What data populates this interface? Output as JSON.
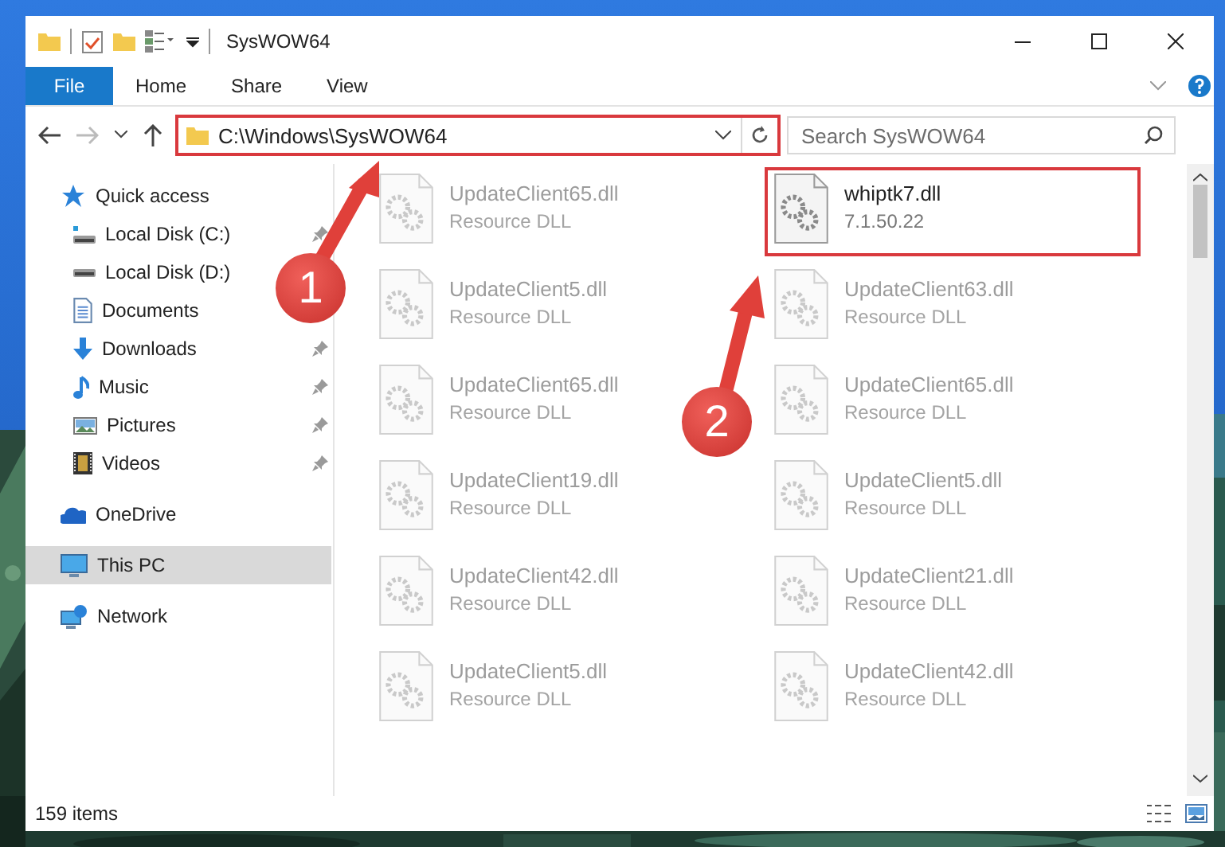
{
  "window": {
    "title": "SysWOW64"
  },
  "ribbon": {
    "tabs": [
      {
        "label": "File",
        "kind": "menu"
      },
      {
        "label": "Home",
        "kind": "tab"
      },
      {
        "label": "Share",
        "kind": "tab"
      },
      {
        "label": "View",
        "kind": "tab"
      }
    ]
  },
  "address_bar": {
    "path": "C:\\Windows\\SysWOW64",
    "highlighted": true
  },
  "search": {
    "placeholder": "Search SysWOW64"
  },
  "navigation": [
    {
      "label": "Quick access",
      "kind": "star",
      "selected": false,
      "children": [
        {
          "label": "Local Disk (C:)",
          "kind": "system-drive",
          "pinned": true,
          "selected": false
        },
        {
          "label": "Local Disk (D:)",
          "kind": "drive",
          "selected": false
        },
        {
          "label": "Documents",
          "kind": "documents",
          "selected": false
        },
        {
          "label": "Downloads",
          "kind": "downloads",
          "pinned": true,
          "selected": false
        },
        {
          "label": "Music",
          "kind": "music",
          "pinned": true,
          "selected": false
        },
        {
          "label": "Pictures",
          "kind": "pictures",
          "pinned": true,
          "selected": false
        },
        {
          "label": "Videos",
          "kind": "videos",
          "pinned": true,
          "selected": false
        }
      ]
    },
    {
      "label": "OneDrive",
      "kind": "cloud",
      "selected": false
    },
    {
      "label": "This PC",
      "kind": "computer",
      "selected": true
    },
    {
      "label": "Network",
      "kind": "network",
      "selected": false
    }
  ],
  "files": [
    {
      "name": "UpdateClient65.dll",
      "detail": "Resource DLL",
      "dimmed": true,
      "highlighted": false
    },
    {
      "name": "whiptk7.dll",
      "detail": "7.1.50.22",
      "dimmed": false,
      "highlighted": true
    },
    {
      "name": "UpdateClient5.dll",
      "detail": "Resource DLL",
      "dimmed": true,
      "highlighted": false
    },
    {
      "name": "UpdateClient63.dll",
      "detail": "Resource DLL",
      "dimmed": true,
      "highlighted": false
    },
    {
      "name": "UpdateClient65.dll",
      "detail": "Resource DLL",
      "dimmed": true,
      "highlighted": false
    },
    {
      "name": "UpdateClient65.dll",
      "detail": "Resource DLL",
      "dimmed": true,
      "highlighted": false
    },
    {
      "name": "UpdateClient19.dll",
      "detail": "Resource DLL",
      "dimmed": true,
      "highlighted": false
    },
    {
      "name": "UpdateClient5.dll",
      "detail": "Resource DLL",
      "dimmed": true,
      "highlighted": false
    },
    {
      "name": "UpdateClient42.dll",
      "detail": "Resource DLL",
      "dimmed": true,
      "highlighted": false
    },
    {
      "name": "UpdateClient21.dll",
      "detail": "Resource DLL",
      "dimmed": true,
      "highlighted": false
    },
    {
      "name": "UpdateClient5.dll",
      "detail": "Resource DLL",
      "dimmed": true,
      "highlighted": false
    },
    {
      "name": "UpdateClient42.dll",
      "detail": "Resource DLL",
      "dimmed": true,
      "highlighted": false
    }
  ],
  "annotations": [
    {
      "number": "1"
    },
    {
      "number": "2"
    }
  ],
  "status_bar": {
    "item_count": "159 items"
  }
}
